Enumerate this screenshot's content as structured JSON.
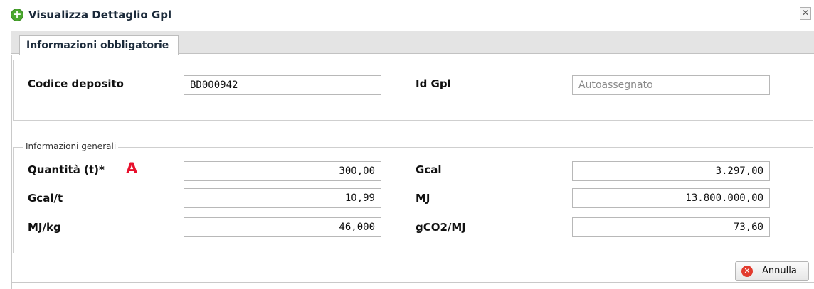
{
  "window": {
    "title": "Visualizza Dettaglio Gpl",
    "close_symbol": "✕"
  },
  "tabs": [
    {
      "label": "Informazioni obbligatorie",
      "active": true
    }
  ],
  "top_section": {
    "codice_deposito": {
      "label": "Codice deposito",
      "value": "BD000942"
    },
    "id_gpl": {
      "label": "Id Gpl",
      "value": "",
      "placeholder": "Autoassegnato"
    }
  },
  "info_generali": {
    "legend": "Informazioni generali",
    "marker": "A",
    "quantita": {
      "label": "Quantità (t)*",
      "value": "300,00"
    },
    "gcal": {
      "label": "Gcal",
      "value": "3.297,00"
    },
    "gcal_t": {
      "label": "Gcal/t",
      "value": "10,99"
    },
    "mj": {
      "label": "MJ",
      "value": "13.800.000,00"
    },
    "mj_kg": {
      "label": "MJ/kg",
      "value": "46,000"
    },
    "gco2_mj": {
      "label": "gCO2/MJ",
      "value": "73,60"
    }
  },
  "footer": {
    "cancel_label": "Annulla"
  },
  "colors": {
    "accent_green": "#4aa82e",
    "marker_red": "#e8112d",
    "cancel_red": "#e23b2e"
  },
  "icons": {
    "title": "add-circle-icon",
    "close": "close-icon",
    "cancel": "cancel-icon"
  }
}
